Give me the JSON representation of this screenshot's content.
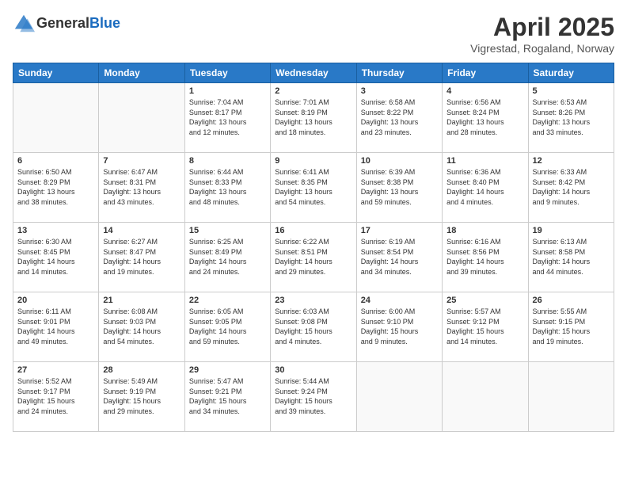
{
  "header": {
    "logo_line1": "General",
    "logo_line2": "Blue",
    "title": "April 2025",
    "subtitle": "Vigrestad, Rogaland, Norway"
  },
  "days_of_week": [
    "Sunday",
    "Monday",
    "Tuesday",
    "Wednesday",
    "Thursday",
    "Friday",
    "Saturday"
  ],
  "weeks": [
    [
      {
        "day": "",
        "info": ""
      },
      {
        "day": "",
        "info": ""
      },
      {
        "day": "1",
        "info": "Sunrise: 7:04 AM\nSunset: 8:17 PM\nDaylight: 13 hours\nand 12 minutes."
      },
      {
        "day": "2",
        "info": "Sunrise: 7:01 AM\nSunset: 8:19 PM\nDaylight: 13 hours\nand 18 minutes."
      },
      {
        "day": "3",
        "info": "Sunrise: 6:58 AM\nSunset: 8:22 PM\nDaylight: 13 hours\nand 23 minutes."
      },
      {
        "day": "4",
        "info": "Sunrise: 6:56 AM\nSunset: 8:24 PM\nDaylight: 13 hours\nand 28 minutes."
      },
      {
        "day": "5",
        "info": "Sunrise: 6:53 AM\nSunset: 8:26 PM\nDaylight: 13 hours\nand 33 minutes."
      }
    ],
    [
      {
        "day": "6",
        "info": "Sunrise: 6:50 AM\nSunset: 8:29 PM\nDaylight: 13 hours\nand 38 minutes."
      },
      {
        "day": "7",
        "info": "Sunrise: 6:47 AM\nSunset: 8:31 PM\nDaylight: 13 hours\nand 43 minutes."
      },
      {
        "day": "8",
        "info": "Sunrise: 6:44 AM\nSunset: 8:33 PM\nDaylight: 13 hours\nand 48 minutes."
      },
      {
        "day": "9",
        "info": "Sunrise: 6:41 AM\nSunset: 8:35 PM\nDaylight: 13 hours\nand 54 minutes."
      },
      {
        "day": "10",
        "info": "Sunrise: 6:39 AM\nSunset: 8:38 PM\nDaylight: 13 hours\nand 59 minutes."
      },
      {
        "day": "11",
        "info": "Sunrise: 6:36 AM\nSunset: 8:40 PM\nDaylight: 14 hours\nand 4 minutes."
      },
      {
        "day": "12",
        "info": "Sunrise: 6:33 AM\nSunset: 8:42 PM\nDaylight: 14 hours\nand 9 minutes."
      }
    ],
    [
      {
        "day": "13",
        "info": "Sunrise: 6:30 AM\nSunset: 8:45 PM\nDaylight: 14 hours\nand 14 minutes."
      },
      {
        "day": "14",
        "info": "Sunrise: 6:27 AM\nSunset: 8:47 PM\nDaylight: 14 hours\nand 19 minutes."
      },
      {
        "day": "15",
        "info": "Sunrise: 6:25 AM\nSunset: 8:49 PM\nDaylight: 14 hours\nand 24 minutes."
      },
      {
        "day": "16",
        "info": "Sunrise: 6:22 AM\nSunset: 8:51 PM\nDaylight: 14 hours\nand 29 minutes."
      },
      {
        "day": "17",
        "info": "Sunrise: 6:19 AM\nSunset: 8:54 PM\nDaylight: 14 hours\nand 34 minutes."
      },
      {
        "day": "18",
        "info": "Sunrise: 6:16 AM\nSunset: 8:56 PM\nDaylight: 14 hours\nand 39 minutes."
      },
      {
        "day": "19",
        "info": "Sunrise: 6:13 AM\nSunset: 8:58 PM\nDaylight: 14 hours\nand 44 minutes."
      }
    ],
    [
      {
        "day": "20",
        "info": "Sunrise: 6:11 AM\nSunset: 9:01 PM\nDaylight: 14 hours\nand 49 minutes."
      },
      {
        "day": "21",
        "info": "Sunrise: 6:08 AM\nSunset: 9:03 PM\nDaylight: 14 hours\nand 54 minutes."
      },
      {
        "day": "22",
        "info": "Sunrise: 6:05 AM\nSunset: 9:05 PM\nDaylight: 14 hours\nand 59 minutes."
      },
      {
        "day": "23",
        "info": "Sunrise: 6:03 AM\nSunset: 9:08 PM\nDaylight: 15 hours\nand 4 minutes."
      },
      {
        "day": "24",
        "info": "Sunrise: 6:00 AM\nSunset: 9:10 PM\nDaylight: 15 hours\nand 9 minutes."
      },
      {
        "day": "25",
        "info": "Sunrise: 5:57 AM\nSunset: 9:12 PM\nDaylight: 15 hours\nand 14 minutes."
      },
      {
        "day": "26",
        "info": "Sunrise: 5:55 AM\nSunset: 9:15 PM\nDaylight: 15 hours\nand 19 minutes."
      }
    ],
    [
      {
        "day": "27",
        "info": "Sunrise: 5:52 AM\nSunset: 9:17 PM\nDaylight: 15 hours\nand 24 minutes."
      },
      {
        "day": "28",
        "info": "Sunrise: 5:49 AM\nSunset: 9:19 PM\nDaylight: 15 hours\nand 29 minutes."
      },
      {
        "day": "29",
        "info": "Sunrise: 5:47 AM\nSunset: 9:21 PM\nDaylight: 15 hours\nand 34 minutes."
      },
      {
        "day": "30",
        "info": "Sunrise: 5:44 AM\nSunset: 9:24 PM\nDaylight: 15 hours\nand 39 minutes."
      },
      {
        "day": "",
        "info": ""
      },
      {
        "day": "",
        "info": ""
      },
      {
        "day": "",
        "info": ""
      }
    ]
  ]
}
